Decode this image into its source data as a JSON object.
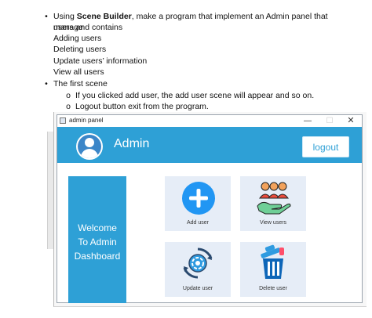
{
  "doc": {
    "bullet1_lead": "Using ",
    "bullet1_bold": "Scene Builder",
    "bullet1_rest": ", make a program that implement an Admin panel that manage",
    "bullet1_cont": "users and contains",
    "items": [
      "Adding users",
      "Deleting users",
      "Update users’ information",
      "View all users"
    ],
    "bullet2": "The first scene",
    "subitems": [
      "If you clicked add user, the add user scene will appear and so on.",
      "Logout button exit from the program."
    ]
  },
  "window": {
    "title": "admin panel",
    "controls": {
      "minimize": "—",
      "maximize": "☐",
      "close": "✕"
    }
  },
  "header": {
    "admin_name": "Admin",
    "logout_label": "logout",
    "color": "#2ea0d6"
  },
  "sidebar": {
    "welcome_lines": [
      "Welcome",
      "To Admin",
      "Dashboard"
    ]
  },
  "cards": {
    "add": {
      "label": "Add user",
      "icon": "plus-circle-icon"
    },
    "view": {
      "label": "View users",
      "icon": "users-hand-icon"
    },
    "update": {
      "label": "Update user",
      "icon": "refresh-gear-icon"
    },
    "delete": {
      "label": "Delete user",
      "icon": "trash-icon"
    }
  }
}
